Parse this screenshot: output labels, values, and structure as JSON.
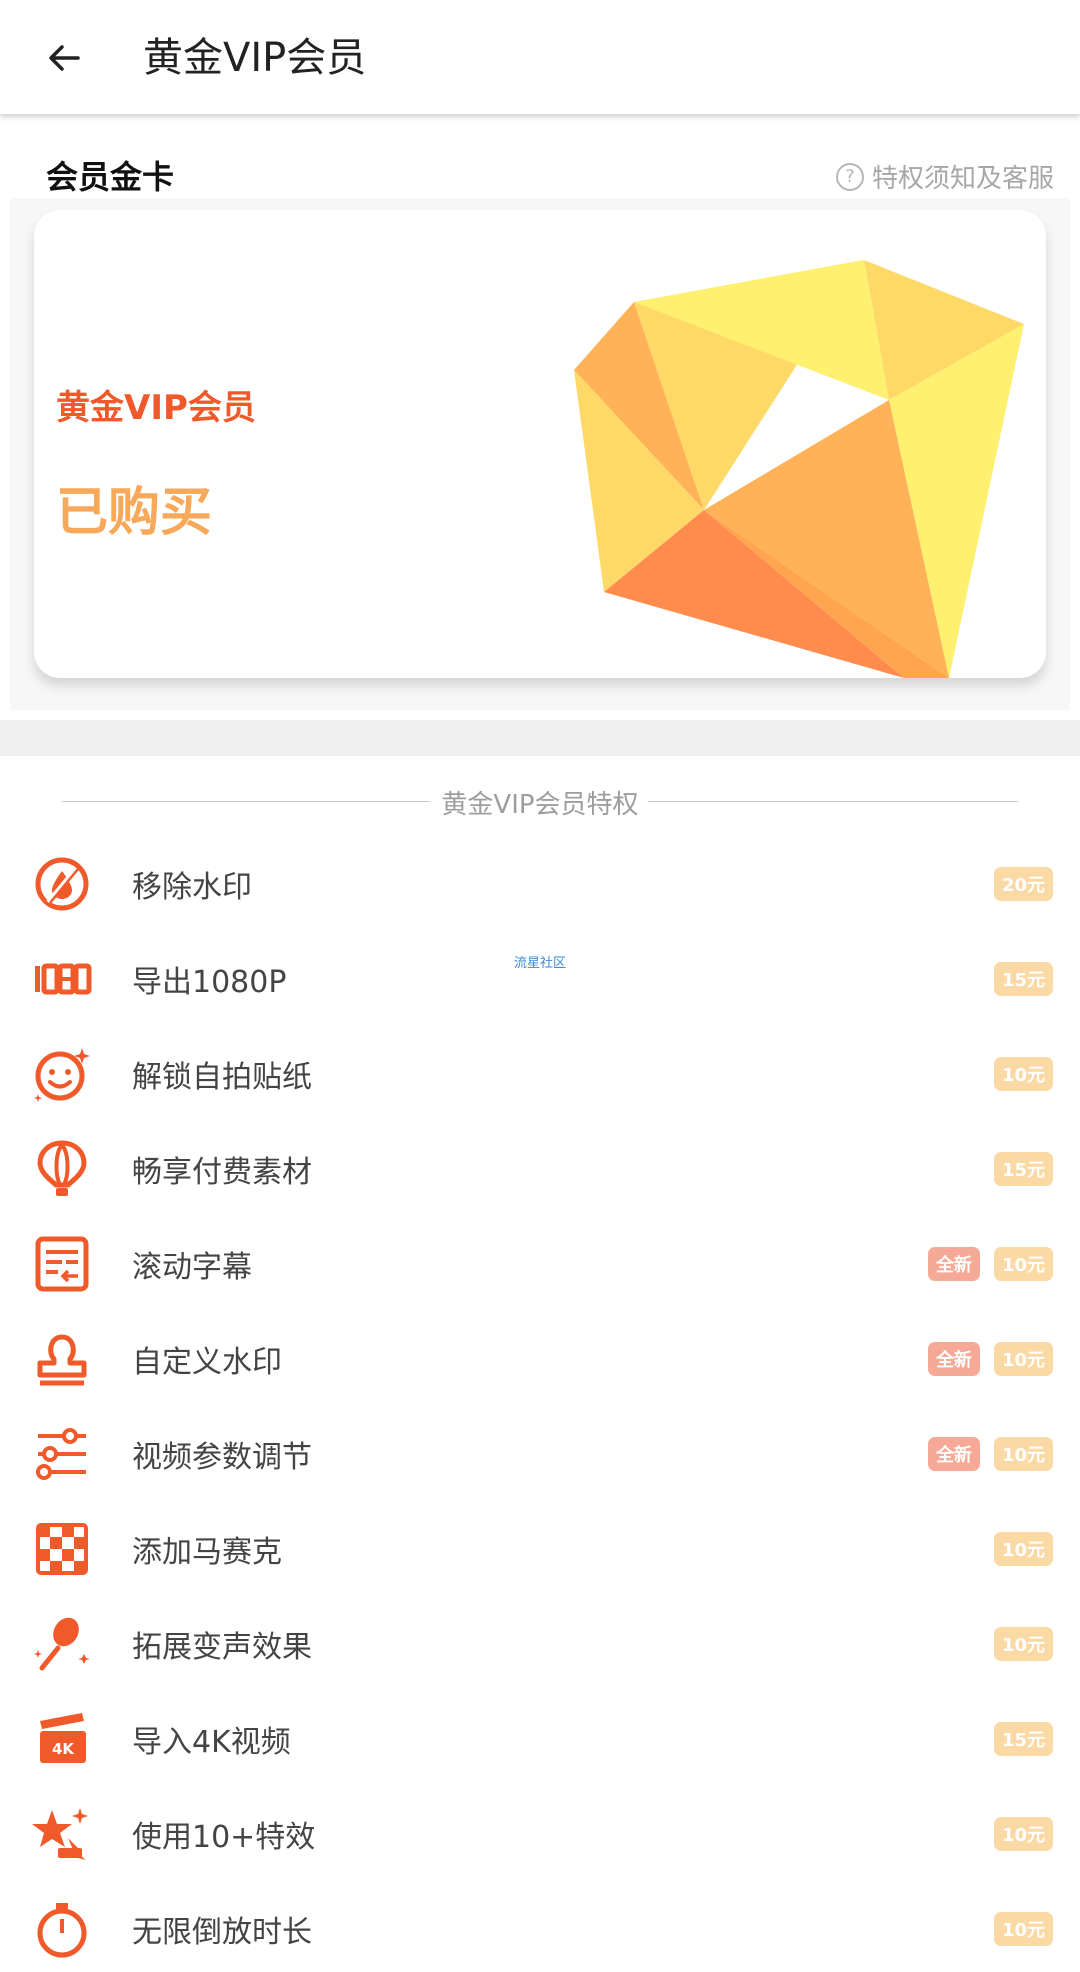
{
  "appbar": {
    "title": "黄金VIP会员"
  },
  "card_section": {
    "title": "会员金卡",
    "help_text": "特权须知及客服",
    "card": {
      "name": "黄金VIP会员",
      "status": "已购买"
    }
  },
  "perks": {
    "header": "黄金VIP会员特权",
    "items": [
      {
        "label": "移除水印",
        "price": "20元",
        "icon": "no-watermark-icon"
      },
      {
        "label": "导出1080P",
        "price": "15元",
        "icon": "export-1080-icon"
      },
      {
        "label": "解锁自拍贴纸",
        "price": "10元",
        "icon": "selfie-sticker-icon"
      },
      {
        "label": "畅享付费素材",
        "price": "15元",
        "icon": "hot-air-balloon-icon"
      },
      {
        "label": "滚动字幕",
        "price": "10元",
        "new": "全新",
        "icon": "scrolling-subtitle-icon"
      },
      {
        "label": "自定义水印",
        "price": "10元",
        "new": "全新",
        "icon": "stamp-icon"
      },
      {
        "label": "视频参数调节",
        "price": "10元",
        "new": "全新",
        "icon": "sliders-icon"
      },
      {
        "label": "添加马赛克",
        "price": "10元",
        "icon": "mosaic-icon"
      },
      {
        "label": "拓展变声效果",
        "price": "10元",
        "icon": "microphone-icon"
      },
      {
        "label": "导入4K视频",
        "price": "15元",
        "icon": "clapperboard-4k-icon"
      },
      {
        "label": "使用10+特效",
        "price": "10元",
        "icon": "star-effect-icon"
      },
      {
        "label": "无限倒放时长",
        "price": "10元",
        "icon": "timer-icon"
      }
    ]
  },
  "watermark": "流星社区",
  "colors": {
    "accent": "#f05a2a",
    "status": "#f7a85a",
    "price_badge": "#fbd9a4",
    "new_badge": "#f5a996"
  }
}
